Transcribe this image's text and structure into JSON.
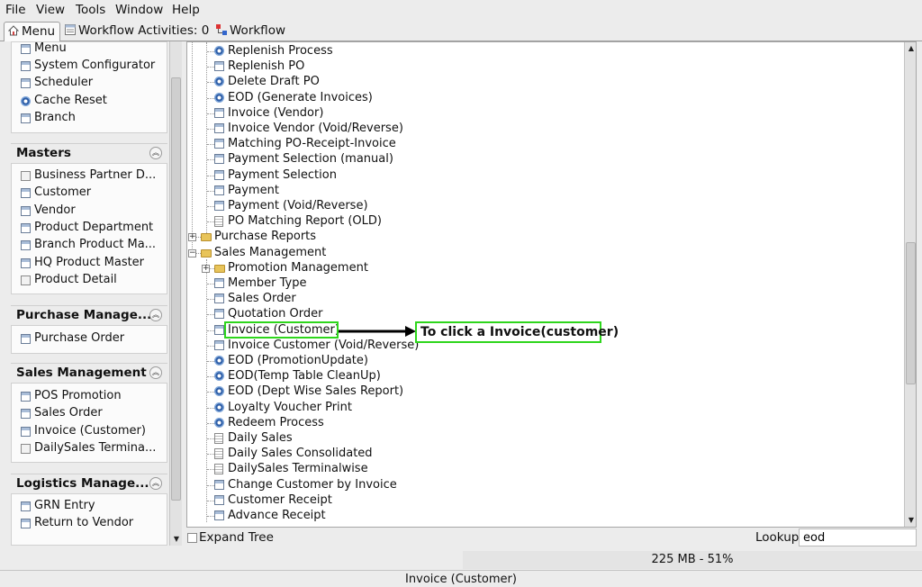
{
  "menubar": {
    "items": [
      {
        "label": "File"
      },
      {
        "label": "View"
      },
      {
        "label": "Tools"
      },
      {
        "label": "Window"
      },
      {
        "label": "Help"
      }
    ]
  },
  "tabs": [
    {
      "label": "Menu",
      "icon": "home-icon",
      "active": true
    },
    {
      "label": "Workflow Activities: 0",
      "icon": "list-icon",
      "active": false
    },
    {
      "label": "Workflow",
      "icon": "workflow-icon",
      "active": false
    }
  ],
  "sidebar": {
    "top_items": [
      {
        "label": "Menu",
        "icon": "window-icon"
      },
      {
        "label": "System Configurator",
        "icon": "window-icon"
      },
      {
        "label": "Scheduler",
        "icon": "window-icon"
      },
      {
        "label": "Cache Reset",
        "icon": "gear-icon"
      },
      {
        "label": "Branch",
        "icon": "window-icon"
      }
    ],
    "groups": [
      {
        "title": "Masters",
        "items": [
          {
            "label": "Business Partner D...",
            "icon": "box-icon"
          },
          {
            "label": "Customer",
            "icon": "window-icon"
          },
          {
            "label": "Vendor",
            "icon": "window-icon"
          },
          {
            "label": "Product Department",
            "icon": "window-icon"
          },
          {
            "label": "Branch Product Ma...",
            "icon": "window-icon"
          },
          {
            "label": "HQ Product Master",
            "icon": "window-icon"
          },
          {
            "label": "Product Detail",
            "icon": "box-icon"
          }
        ]
      },
      {
        "title": "Purchase Manage...",
        "items": [
          {
            "label": "Purchase Order",
            "icon": "window-icon"
          }
        ]
      },
      {
        "title": "Sales Management",
        "items": [
          {
            "label": "POS Promotion",
            "icon": "window-icon"
          },
          {
            "label": "Sales Order",
            "icon": "window-icon"
          },
          {
            "label": "Invoice (Customer)",
            "icon": "window-icon"
          },
          {
            "label": "DailySales Termina...",
            "icon": "box-icon"
          }
        ]
      },
      {
        "title": "Logistics Manage...",
        "items": [
          {
            "label": "GRN Entry",
            "icon": "window-icon"
          },
          {
            "label": "Return to Vendor",
            "icon": "window-icon"
          }
        ]
      }
    ]
  },
  "tree": {
    "items": [
      {
        "label": "Replenish Process",
        "icon": "gear-icon"
      },
      {
        "label": "Replenish PO",
        "icon": "window-icon"
      },
      {
        "label": "Delete Draft PO",
        "icon": "gear-icon"
      },
      {
        "label": "EOD (Generate Invoices)",
        "icon": "gear-icon"
      },
      {
        "label": "Invoice (Vendor)",
        "icon": "window-icon"
      },
      {
        "label": "Invoice Vendor (Void/Reverse)",
        "icon": "window-icon"
      },
      {
        "label": "Matching PO-Receipt-Invoice",
        "icon": "window-icon"
      },
      {
        "label": "Payment Selection (manual)",
        "icon": "window-icon"
      },
      {
        "label": "Payment Selection",
        "icon": "window-icon"
      },
      {
        "label": "Payment",
        "icon": "window-icon"
      },
      {
        "label": "Payment (Void/Reverse)",
        "icon": "window-icon"
      },
      {
        "label": "PO Matching Report (OLD)",
        "icon": "doc-icon"
      },
      {
        "label": "Purchase Reports",
        "icon": "folder-icon"
      },
      {
        "label": "Sales Management",
        "icon": "folder-open-icon"
      },
      {
        "label": "Promotion Management",
        "icon": "folder-icon"
      },
      {
        "label": "Member Type",
        "icon": "window-icon"
      },
      {
        "label": "Sales Order",
        "icon": "window-icon"
      },
      {
        "label": "Quotation Order",
        "icon": "window-icon"
      },
      {
        "label": "Invoice (Customer)",
        "icon": "window-icon"
      },
      {
        "label": "Invoice Customer (Void/Reverse)",
        "icon": "window-icon"
      },
      {
        "label": "EOD (PromotionUpdate)",
        "icon": "gear-icon"
      },
      {
        "label": "EOD(Temp Table CleanUp)",
        "icon": "gear-icon"
      },
      {
        "label": "EOD (Dept Wise Sales Report)",
        "icon": "gear-icon"
      },
      {
        "label": "Loyalty Voucher Print",
        "icon": "gear-icon"
      },
      {
        "label": "Redeem Process",
        "icon": "gear-icon"
      },
      {
        "label": "Daily Sales",
        "icon": "doc-icon"
      },
      {
        "label": "Daily Sales Consolidated",
        "icon": "doc-icon"
      },
      {
        "label": "DailySales Terminalwise",
        "icon": "doc-icon"
      },
      {
        "label": "Change Customer by Invoice",
        "icon": "window-icon"
      },
      {
        "label": "Customer Receipt",
        "icon": "window-icon"
      },
      {
        "label": "Advance Receipt",
        "icon": "window-icon"
      }
    ]
  },
  "annotation": {
    "text": "To click a Invoice(customer)",
    "color": "#2ed61c"
  },
  "bottom": {
    "expand_tree_label": "Expand Tree",
    "lookup_label": "Lookup",
    "lookup_value": "eod"
  },
  "memory": "225 MB - 51%",
  "status": "Invoice (Customer)"
}
